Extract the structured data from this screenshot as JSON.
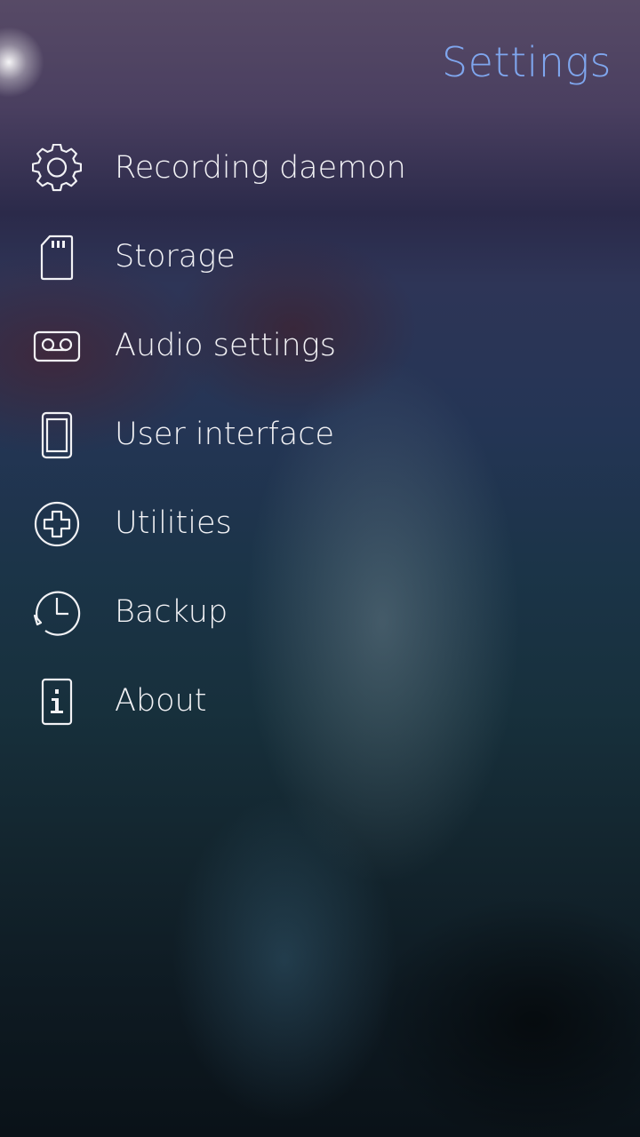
{
  "page": {
    "title": "Settings",
    "accent_color": "#7fa6ee",
    "text_color": "#f2f2f5"
  },
  "menu": {
    "items": [
      {
        "label": "Recording daemon",
        "icon": "gear-icon"
      },
      {
        "label": "Storage",
        "icon": "sd-card-icon"
      },
      {
        "label": "Audio settings",
        "icon": "cassette-icon"
      },
      {
        "label": "User interface",
        "icon": "phone-icon"
      },
      {
        "label": "Utilities",
        "icon": "plus-circle-icon"
      },
      {
        "label": "Backup",
        "icon": "clock-icon"
      },
      {
        "label": "About",
        "icon": "info-icon"
      }
    ]
  }
}
